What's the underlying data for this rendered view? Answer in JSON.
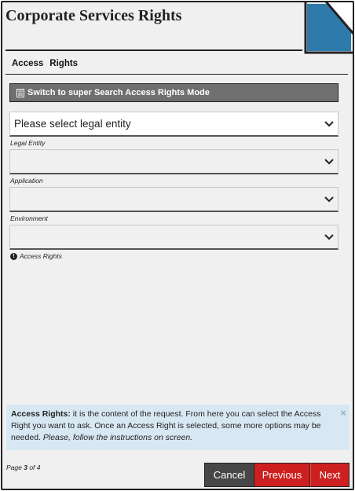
{
  "header": {
    "title": "Corporate Services Rights"
  },
  "tabs": [
    "Access",
    "Rights"
  ],
  "mode_button": {
    "label": "Switch to super Search Access Rights Mode",
    "icon": "list-icon"
  },
  "fields": [
    {
      "value": "Please select legal entity",
      "label": "Legal Entity"
    },
    {
      "value": "",
      "label": "Application"
    },
    {
      "value": "",
      "label": "Environment"
    },
    {
      "value": "",
      "label": "Access Rights",
      "info_icon": "info-icon"
    }
  ],
  "info": {
    "bold": "Access Rights:",
    "text": " it is the content of the request. From here you can select the Access Right you want to ask. Once an Access Right is selected, some more options may be needed. ",
    "italic": "Please, follow the instructions on screen.",
    "close": "×"
  },
  "pager": {
    "prefix": "Page ",
    "current": "3",
    "suffix": " of 4"
  },
  "buttons": {
    "cancel": "Cancel",
    "previous": "Previous",
    "next": "Next"
  },
  "colors": {
    "accent": "#cd1f1f",
    "corner": "#2e7aab",
    "info_bg": "#d7e8f3"
  }
}
